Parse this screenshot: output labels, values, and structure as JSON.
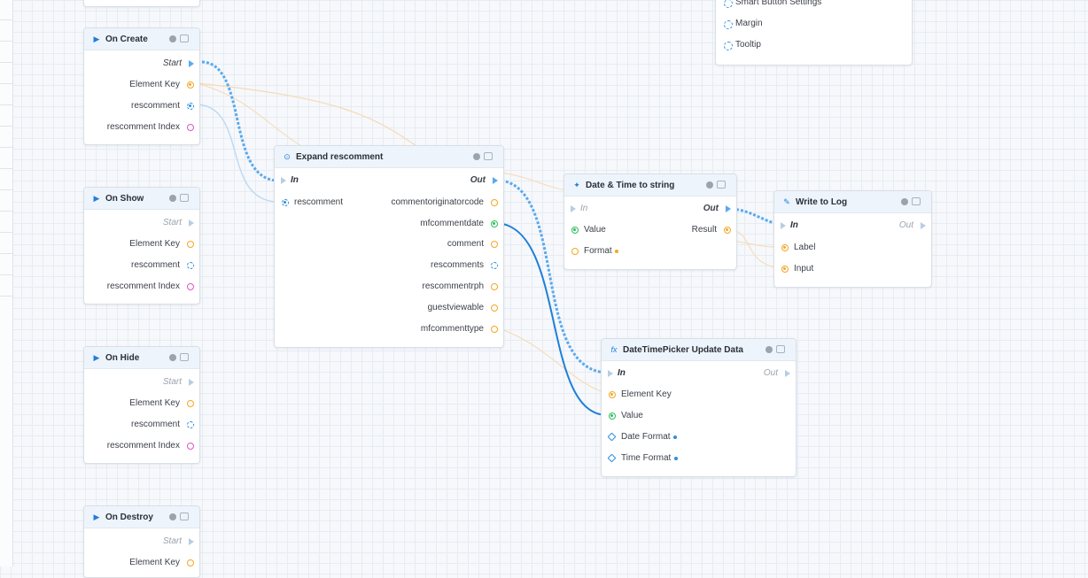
{
  "colors": {
    "exec_wire": "#5aa9ef",
    "data_wire": "#1f7fd8",
    "accent_orange": "#f5a623",
    "accent_pink": "#e052c9",
    "accent_green": "#2bbf5a",
    "header_bg": "#eef4fb"
  },
  "top_panel": {
    "items": [
      "Smart Button Settings",
      "Margin",
      "Tooltip"
    ]
  },
  "events": {
    "on_create": {
      "title": "On Create",
      "start": "Start",
      "pins": [
        "Element Key",
        "rescomment",
        "rescomment Index"
      ]
    },
    "on_show": {
      "title": "On Show",
      "start": "Start",
      "pins": [
        "Element Key",
        "rescomment",
        "rescomment Index"
      ]
    },
    "on_hide": {
      "title": "On Hide",
      "start": "Start",
      "pins": [
        "Element Key",
        "rescomment",
        "rescomment Index"
      ]
    },
    "on_destroy": {
      "title": "On Destroy",
      "start": "Start",
      "pins": [
        "Element Key"
      ]
    }
  },
  "expand": {
    "title": "Expand rescomment",
    "in": "In",
    "out": "Out",
    "input_pin": "rescomment",
    "outputs": [
      "commentoriginatorcode",
      "mfcommentdate",
      "comment",
      "rescomments",
      "rescommentrph",
      "guestviewable",
      "mfcommenttype"
    ]
  },
  "datetime_string": {
    "title": "Date & Time to string",
    "in": "In",
    "out": "Out",
    "inputs": [
      "Value",
      "Format"
    ],
    "output": "Result"
  },
  "write_log": {
    "title": "Write to Log",
    "in": "In",
    "out": "Out",
    "inputs": [
      "Label",
      "Input"
    ]
  },
  "dtp_update": {
    "title": "DateTimePicker Update Data",
    "in": "In",
    "out": "Out",
    "inputs": [
      "Element Key",
      "Value",
      "Date Format",
      "Time Format"
    ]
  }
}
